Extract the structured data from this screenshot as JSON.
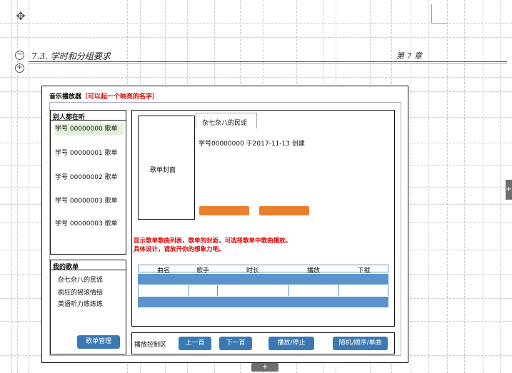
{
  "doc_header": {
    "section": "7.3.  学时和分组要求",
    "chapter": "第 7 章"
  },
  "app": {
    "title": "音乐播放器",
    "title_note": "（可以起一个响亮的名字）"
  },
  "others": {
    "heading": "别人都在听",
    "items": [
      {
        "label": "学号 00000000 歌单"
      },
      {
        "label": "学号 00000001 歌单"
      },
      {
        "label": "学号 00000002 歌单"
      },
      {
        "label": "学号 00000003 歌单"
      },
      {
        "label": "学号 00000003 歌单"
      }
    ]
  },
  "mine": {
    "heading": "我的歌单",
    "items": [
      {
        "label": "杂七杂八的民谣"
      },
      {
        "label": "疯狂的摇滚情结"
      },
      {
        "label": "英语听力练练练"
      }
    ],
    "manage_label": "歌单管理"
  },
  "playlist": {
    "cover_label": "歌单封面",
    "tab_label": "杂七杂八的民谣",
    "created": "学号00000000 于2017-11-13 创建",
    "hint_line1": "显示歌单歌曲列表，歌单的封面，可选择歌单中歌曲播放。",
    "hint_line2": "具体设计，请放开你的想象力吧。",
    "columns": [
      "曲名",
      "歌手",
      "时长",
      "播放",
      "下载"
    ]
  },
  "controls": {
    "label": "播放控制区",
    "prev": "上一首",
    "next": "下一首",
    "play": "播放/停止",
    "mode": "随机/顺序/单曲"
  },
  "colors": {
    "accent_blue": "#3b79b5",
    "bar_blue": "#5b93cc",
    "orange": "#ec7f2e",
    "highlight_green": "#e3f1da",
    "red": "#e00000"
  }
}
